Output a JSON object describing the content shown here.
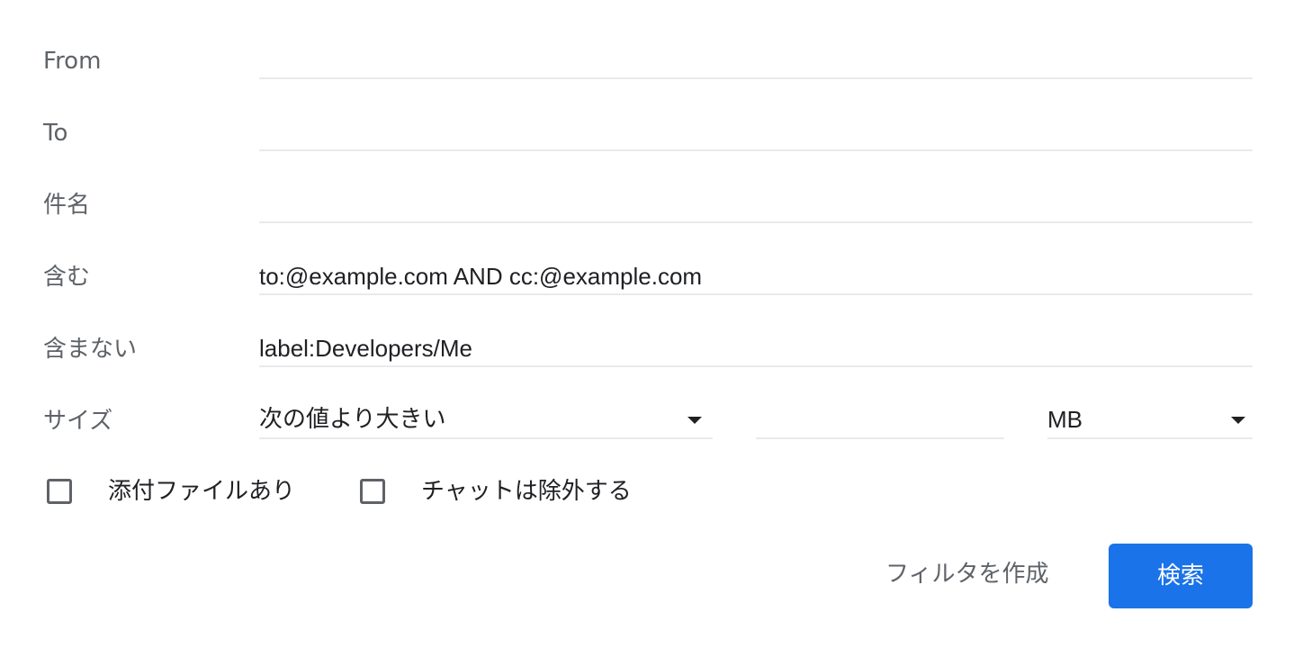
{
  "form": {
    "from": {
      "label": "From",
      "value": ""
    },
    "to": {
      "label": "To",
      "value": ""
    },
    "subject": {
      "label": "件名",
      "value": ""
    },
    "has_words": {
      "label": "含む",
      "value": "to:@example.com AND cc:@example.com"
    },
    "doesnt_have": {
      "label": "含まない",
      "value": "label:Developers/Me"
    },
    "size": {
      "label": "サイズ",
      "operator": "次の値より大きい",
      "amount": "",
      "unit": "MB"
    },
    "has_attachment": {
      "label": "添付ファイルあり",
      "checked": false
    },
    "exclude_chats": {
      "label": "チャットは除外する",
      "checked": false
    }
  },
  "actions": {
    "create_filter": "フィルタを作成",
    "search": "検索"
  },
  "colors": {
    "primary": "#1a73e8",
    "label_gray": "#5f6368",
    "divider": "#e8eaed"
  }
}
